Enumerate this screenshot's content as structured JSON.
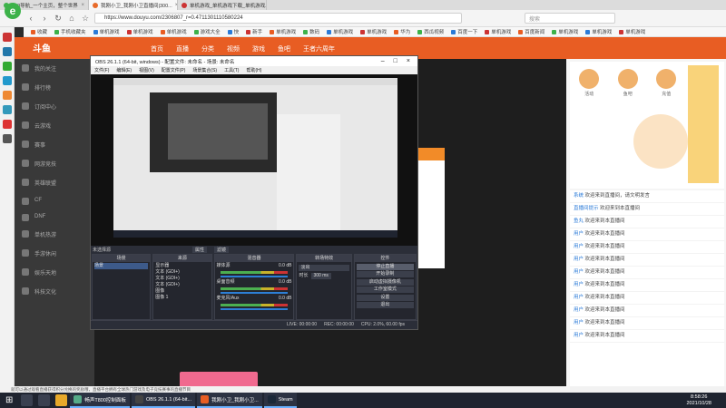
{
  "browser": {
    "tabs": [
      {
        "title": "360导航_一个主页，整个世界",
        "active": false
      },
      {
        "title": "我刚小卫_我刚小卫直播间|300...",
        "active": true
      },
      {
        "title": "单机游戏_单机游戏下载_单机游戏...",
        "active": false
      },
      {
        "title": "",
        "active": false
      }
    ],
    "url": "https://www.douyu.com/2306807_r=0.4711301110580224",
    "search_placeholder": "搜索",
    "bookmarks": [
      "收藏",
      "手机收藏夹",
      "单机游戏",
      "单机游戏",
      "单机游戏",
      "游戏大全",
      "快",
      "新手",
      "单机游戏",
      "数码",
      "单机游戏",
      "单机游戏",
      "华为",
      "西瓜视频",
      "百度一下",
      "单机游戏",
      "百度新闻",
      "单机游戏",
      "单机游戏",
      "单机游戏"
    ],
    "status_text": "就可以通过观看直播获得积分兑换的奖励哦，直播平台拥有全球热门游戏及电子竞技赛事的直播节目"
  },
  "douyu": {
    "logo": "斗鱼",
    "nav": [
      "首页",
      "直播",
      "分类",
      "视频",
      "游戏",
      "鱼吧",
      "王者六周年"
    ],
    "left_items": [
      "我的关注",
      "排行榜",
      "订阅中心",
      "云游戏",
      "赛事",
      "网游竞技",
      "英雄联盟",
      "CF",
      "DNF",
      "单机热游",
      "手游休闲",
      "娱乐天地",
      "科技文化"
    ],
    "right_icons": [
      "活动",
      "鱼吧",
      "充值",
      "任务"
    ],
    "chat": [
      {
        "who": "系统",
        "text": "欢迎来到直播间，请文明发言"
      },
      {
        "who": "直播间提示",
        "text": "欢迎来到本直播间"
      },
      {
        "who": "鱼丸",
        "text": "欢迎来到本直播间"
      },
      {
        "who": "用户",
        "text": "欢迎来到本直播间"
      },
      {
        "who": "用户",
        "text": "欢迎来到本直播间"
      },
      {
        "who": "用户",
        "text": "欢迎来到本直播间"
      },
      {
        "who": "用户",
        "text": "欢迎来到本直播间"
      },
      {
        "who": "用户",
        "text": "欢迎来到本直播间"
      },
      {
        "who": "用户",
        "text": "欢迎来到本直播间"
      },
      {
        "who": "用户",
        "text": "欢迎来到本直播间"
      },
      {
        "who": "用户",
        "text": "欢迎来到本直播间"
      },
      {
        "who": "用户",
        "text": "欢迎来到本直播间"
      }
    ]
  },
  "obs": {
    "title": "OBS 26.1.1 (64-bit, windows) - 配置文件: 未命名 - 场景: 未命名",
    "menu": [
      "文件(F)",
      "编辑(E)",
      "视图(V)",
      "配置文件(P)",
      "场景集合(S)",
      "工具(T)",
      "帮助(H)"
    ],
    "no_source": "未选择源",
    "props_btn": "属性",
    "filters_btn": "滤镜",
    "docks": {
      "scenes": {
        "title": "场景",
        "items": [
          "场景"
        ]
      },
      "sources": {
        "title": "来源",
        "items": [
          "显示器",
          "文本 (GDI+)",
          "文本 (GDI+)",
          "文本 (GDI+)",
          "图像",
          "图像 1"
        ]
      },
      "mixer": {
        "title": "混音器",
        "channels": [
          "媒体源",
          "桌面音频",
          "麦克风/Aux"
        ],
        "levels": [
          "0.0 dB",
          "0.0 dB",
          "0.0 dB"
        ]
      },
      "transitions": {
        "title": "转场特效",
        "type": "淡出",
        "duration_label": "时长",
        "duration": "300 ms"
      },
      "controls": {
        "title": "控件",
        "buttons": [
          "停止直播",
          "开始录制",
          "启动虚拟摄像机",
          "工作室模式",
          "设置",
          "退出"
        ]
      }
    },
    "statusbar": {
      "live": "LIVE: 00:00:00",
      "rec": "REC: 00:00:00",
      "cpu": "CPU: 2.0%, 60.00 fps"
    }
  },
  "taskbar": {
    "apps": [
      "畅声T800控制面板",
      "OBS 26.1.1 (64-bit...",
      "我刚小卫_我刚小卫...",
      "Steam"
    ],
    "time": "8:58:26",
    "date": "2021/10/28"
  },
  "colors": {
    "douyu_orange": "#e85d23",
    "obs_bg": "#2b2e38",
    "taskbar": "#1f2430",
    "browser_green": "#3db24a"
  }
}
